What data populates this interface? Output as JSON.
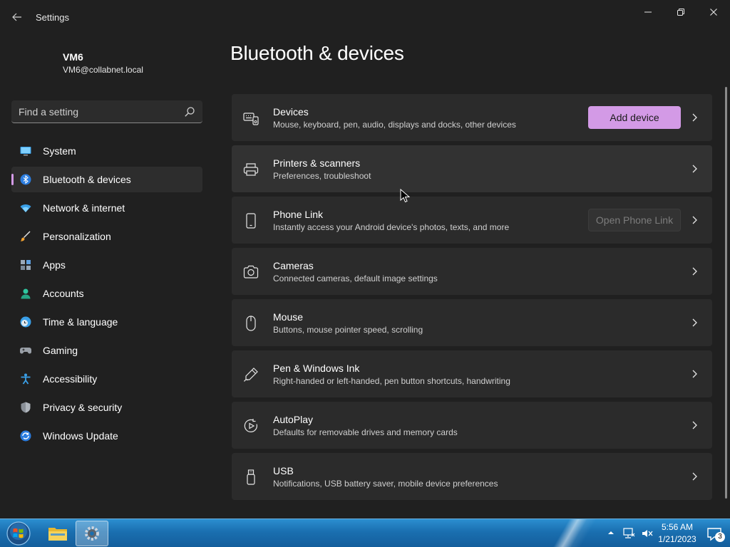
{
  "window": {
    "title": "Settings",
    "controls": [
      "minimize-icon",
      "maximize-icon",
      "close-icon"
    ]
  },
  "profile": {
    "name": "VM6",
    "email": "VM6@collabnet.local"
  },
  "search": {
    "placeholder": "Find a setting",
    "value": ""
  },
  "nav": {
    "items": [
      {
        "label": "System",
        "icon": "system-icon"
      },
      {
        "label": "Bluetooth & devices",
        "icon": "bluetooth-icon",
        "selected": true
      },
      {
        "label": "Network & internet",
        "icon": "wifi-icon"
      },
      {
        "label": "Personalization",
        "icon": "brush-icon"
      },
      {
        "label": "Apps",
        "icon": "apps-icon"
      },
      {
        "label": "Accounts",
        "icon": "accounts-icon"
      },
      {
        "label": "Time & language",
        "icon": "clock-globe-icon"
      },
      {
        "label": "Gaming",
        "icon": "gamepad-icon"
      },
      {
        "label": "Accessibility",
        "icon": "accessibility-icon"
      },
      {
        "label": "Privacy & security",
        "icon": "shield-icon"
      },
      {
        "label": "Windows Update",
        "icon": "update-icon"
      }
    ]
  },
  "main": {
    "title": "Bluetooth & devices",
    "cards": [
      {
        "title": "Devices",
        "subtitle": "Mouse, keyboard, pen, audio, displays and docks, other devices",
        "icon": "devices-icon",
        "button": "Add device"
      },
      {
        "title": "Printers & scanners",
        "subtitle": "Preferences, troubleshoot",
        "icon": "printer-icon"
      },
      {
        "title": "Phone Link",
        "subtitle": "Instantly access your Android device's photos, texts, and more",
        "icon": "phone-icon",
        "button": "Open Phone Link"
      },
      {
        "title": "Cameras",
        "subtitle": "Connected cameras, default image settings",
        "icon": "camera-icon"
      },
      {
        "title": "Mouse",
        "subtitle": "Buttons, mouse pointer speed, scrolling",
        "icon": "mouse-icon"
      },
      {
        "title": "Pen & Windows Ink",
        "subtitle": "Right-handed or left-handed, pen button shortcuts, handwriting",
        "icon": "pen-icon"
      },
      {
        "title": "AutoPlay",
        "subtitle": "Defaults for removable drives and memory cards",
        "icon": "autoplay-icon"
      },
      {
        "title": "USB",
        "subtitle": "Notifications, USB battery saver, mobile device preferences",
        "icon": "usb-icon"
      }
    ]
  },
  "taskbar": {
    "time": "5:56 AM",
    "date": "1/21/2023",
    "notification_count": "3",
    "pinned": [
      "windows-start-icon",
      "file-explorer-icon",
      "settings-gear-icon"
    ]
  },
  "colors": {
    "background": "#202020",
    "card": "#2b2b2b",
    "accent": "#d39ae6",
    "taskbar": "#1a6fb0"
  }
}
